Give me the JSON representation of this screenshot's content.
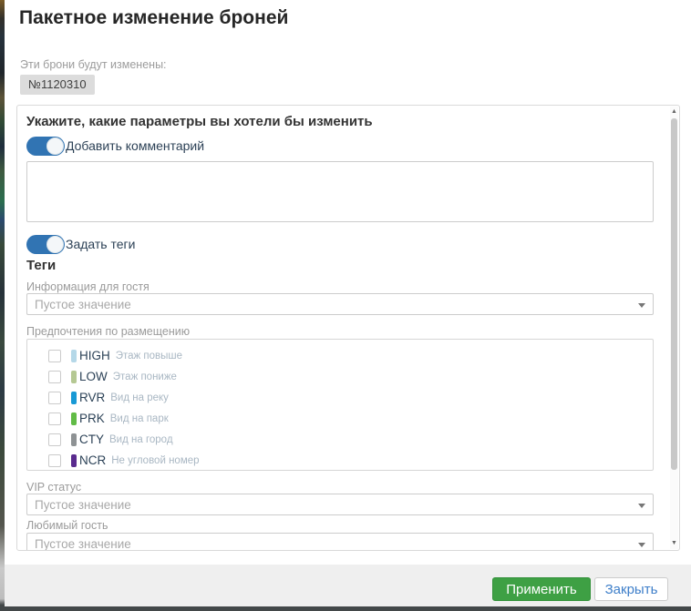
{
  "dialog": {
    "title": "Пакетное изменение броней",
    "affected_label": "Эти брони будут изменены:",
    "booking_badge": "№1120310",
    "params_header": "Укажите, какие параметры вы хотели бы изменить",
    "toggles": {
      "add_comment": "Добавить комментарий",
      "set_tags": "Задать теги"
    },
    "comment_value": "",
    "tags_header": "Теги",
    "fields": [
      {
        "label": "Информация для гостя",
        "value": "Пустое значение"
      },
      {
        "label": "VIP статус",
        "value": "Пустое значение"
      },
      {
        "label": "Любимый гость",
        "value": "Пустое значение"
      }
    ],
    "tag_group": {
      "label": "Предпочтения по размещению",
      "options": [
        {
          "code": "HIGH",
          "desc": "Этаж повыше",
          "color": "#b5d8e8"
        },
        {
          "code": "LOW",
          "desc": "Этаж пониже",
          "color": "#b5c893"
        },
        {
          "code": "RVR",
          "desc": "Вид на реку",
          "color": "#1899d5"
        },
        {
          "code": "PRK",
          "desc": "Вид на парк",
          "color": "#61bb46"
        },
        {
          "code": "CTY",
          "desc": "Вид на город",
          "color": "#8e9294"
        },
        {
          "code": "NCR",
          "desc": "Не угловой номер",
          "color": "#5a2b8e"
        }
      ]
    },
    "scrollbar": {
      "up_icon": "▲",
      "down_icon": "▼"
    },
    "footer": {
      "apply_label": "Применить",
      "close_label": "Закрыть"
    },
    "colors": {
      "toggle_on": "#3174b3",
      "apply_green": "#3ea044",
      "close_text_blue": "#3d7ec9"
    }
  }
}
